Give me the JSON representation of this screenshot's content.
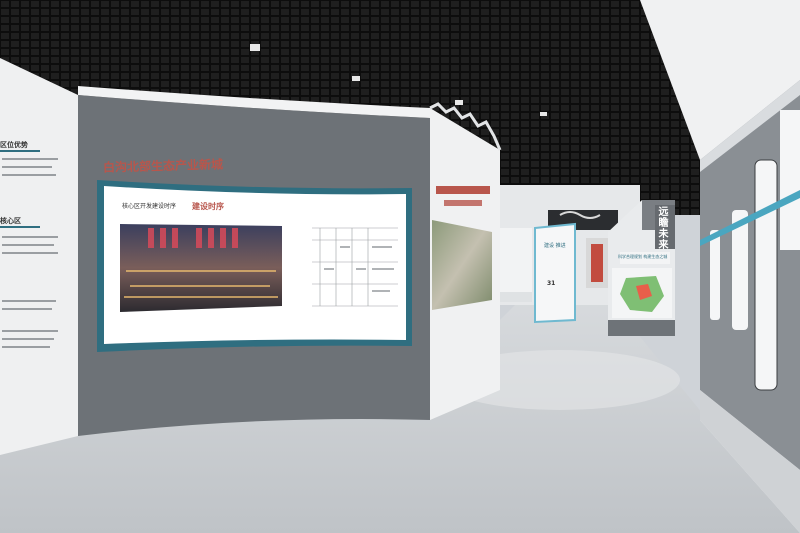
{
  "main_wall": {
    "title": "白沟北部生态产业新城",
    "screen": {
      "left_heading": "核心区开发建设时序",
      "right_heading": "建设时序"
    }
  },
  "left_wall": {
    "heading_1": "区位优势",
    "heading_2": "核心区"
  },
  "right_panel": {
    "big_text": "远瞻未来",
    "sub_text": "科学合理规划 构建生态之城"
  },
  "far_wall": {
    "label": "建设 推进",
    "number": "31"
  },
  "colors": {
    "ceiling": "#111111",
    "floor": "#c9ccd0",
    "wall_gray": "#6d7277",
    "accent_teal": "#2f6e80",
    "title_red": "#b8564c"
  }
}
